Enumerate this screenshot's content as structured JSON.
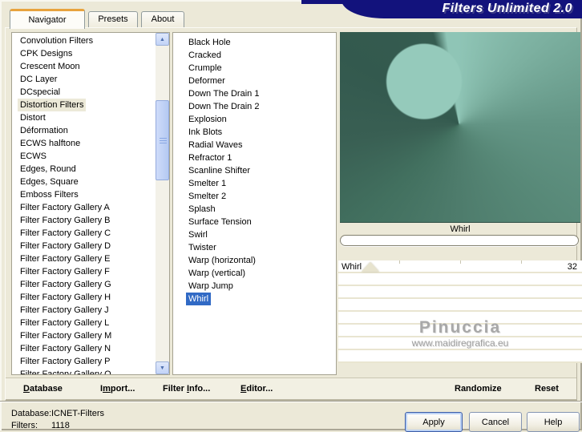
{
  "window": {
    "title": "Filters Unlimited 2.0",
    "tabs": [
      {
        "label": "Navigator"
      },
      {
        "label": "Presets"
      },
      {
        "label": "About"
      }
    ]
  },
  "left_list": {
    "items": [
      "Convolution Filters",
      "CPK Designs",
      "Crescent Moon",
      "DC Layer",
      "DCspecial",
      "Distortion Filters",
      "Distort",
      "Déformation",
      "ECWS halftone",
      "ECWS",
      "Edges, Round",
      "Edges, Square",
      "Emboss Filters",
      "Filter Factory Gallery A",
      "Filter Factory Gallery B",
      "Filter Factory Gallery C",
      "Filter Factory Gallery D",
      "Filter Factory Gallery E",
      "Filter Factory Gallery F",
      "Filter Factory Gallery G",
      "Filter Factory Gallery H",
      "Filter Factory Gallery J",
      "Filter Factory Gallery L",
      "Filter Factory Gallery M",
      "Filter Factory Gallery N",
      "Filter Factory Gallery P",
      "Filter Factory Gallery Q"
    ],
    "selected": "Distortion Filters"
  },
  "filter_list": {
    "items": [
      "Black Hole",
      "Cracked",
      "Crumple",
      "Deformer",
      "Down The Drain 1",
      "Down The Drain 2",
      "Explosion",
      "Ink Blots",
      "Radial Waves",
      "Refractor 1",
      "Scanline Shifter",
      "Smelter 1",
      "Smelter 2",
      "Splash",
      "Surface Tension",
      "Swirl",
      "Twister",
      "Warp (horizontal)",
      "Warp (vertical)",
      "Warp Jump",
      "Whirl"
    ],
    "selected": "Whirl"
  },
  "preview": {
    "filter_name": "Whirl",
    "colors": {
      "dark": "#33594e",
      "mid": "#5f9282",
      "light": "#8fc5b6"
    }
  },
  "controls": [
    {
      "name": "Whirl",
      "value": "32"
    }
  ],
  "watermark": {
    "line1": "Pinuccia",
    "line2": "www.maidiregrafica.eu"
  },
  "icons": {
    "scroll_up": "▲",
    "scroll_down": "▼"
  },
  "toolbar": {
    "database": {
      "pre": "",
      "key": "D",
      "post": "atabase"
    },
    "import": {
      "pre": "I",
      "key": "m",
      "post": "port..."
    },
    "filter_info": {
      "pre": "Filter ",
      "key": "I",
      "post": "nfo..."
    },
    "editor": {
      "pre": "",
      "key": "E",
      "post": "ditor..."
    },
    "randomize": "Randomize",
    "reset": "Reset"
  },
  "status": {
    "database_label": "Database:",
    "database_value": "ICNET-Filters",
    "filters_label": "Filters:",
    "filters_value": "1118"
  },
  "buttons": {
    "apply": "Apply",
    "cancel": "Cancel",
    "help": "Help"
  }
}
